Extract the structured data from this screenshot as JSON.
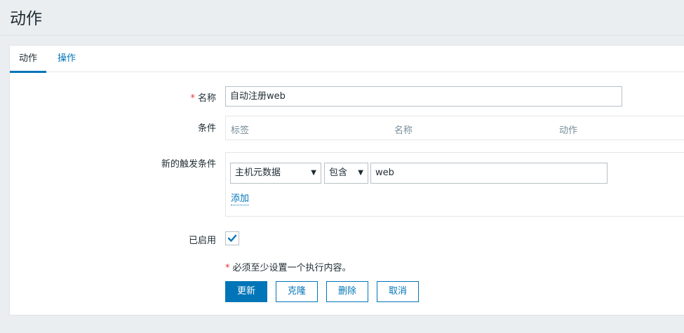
{
  "page": {
    "title": "动作"
  },
  "tabs": [
    {
      "label": "动作",
      "active": true
    },
    {
      "label": "操作",
      "active": false
    }
  ],
  "form": {
    "name": {
      "label": "名称",
      "required_mark": "*",
      "value": "自动注册web"
    },
    "conditions": {
      "label": "条件",
      "columns": [
        "标签",
        "名称",
        "动作"
      ]
    },
    "new_condition": {
      "label": "新的触发条件",
      "type_select": "主机元数据",
      "operator_select": "包含",
      "value": "web",
      "add_link": "添加"
    },
    "enabled": {
      "label": "已启用",
      "checked": true
    },
    "note": {
      "required_mark": "*",
      "text": "必须至少设置一个执行内容。"
    }
  },
  "buttons": {
    "update": "更新",
    "clone": "克隆",
    "delete": "删除",
    "cancel": "取消"
  },
  "colors": {
    "accent": "#0275b8",
    "required": "#e33734",
    "muted": "#768d99",
    "background": "#ebeef0"
  },
  "icons": {
    "dropdown": "triangle-down",
    "checkbox": "checkmark"
  }
}
